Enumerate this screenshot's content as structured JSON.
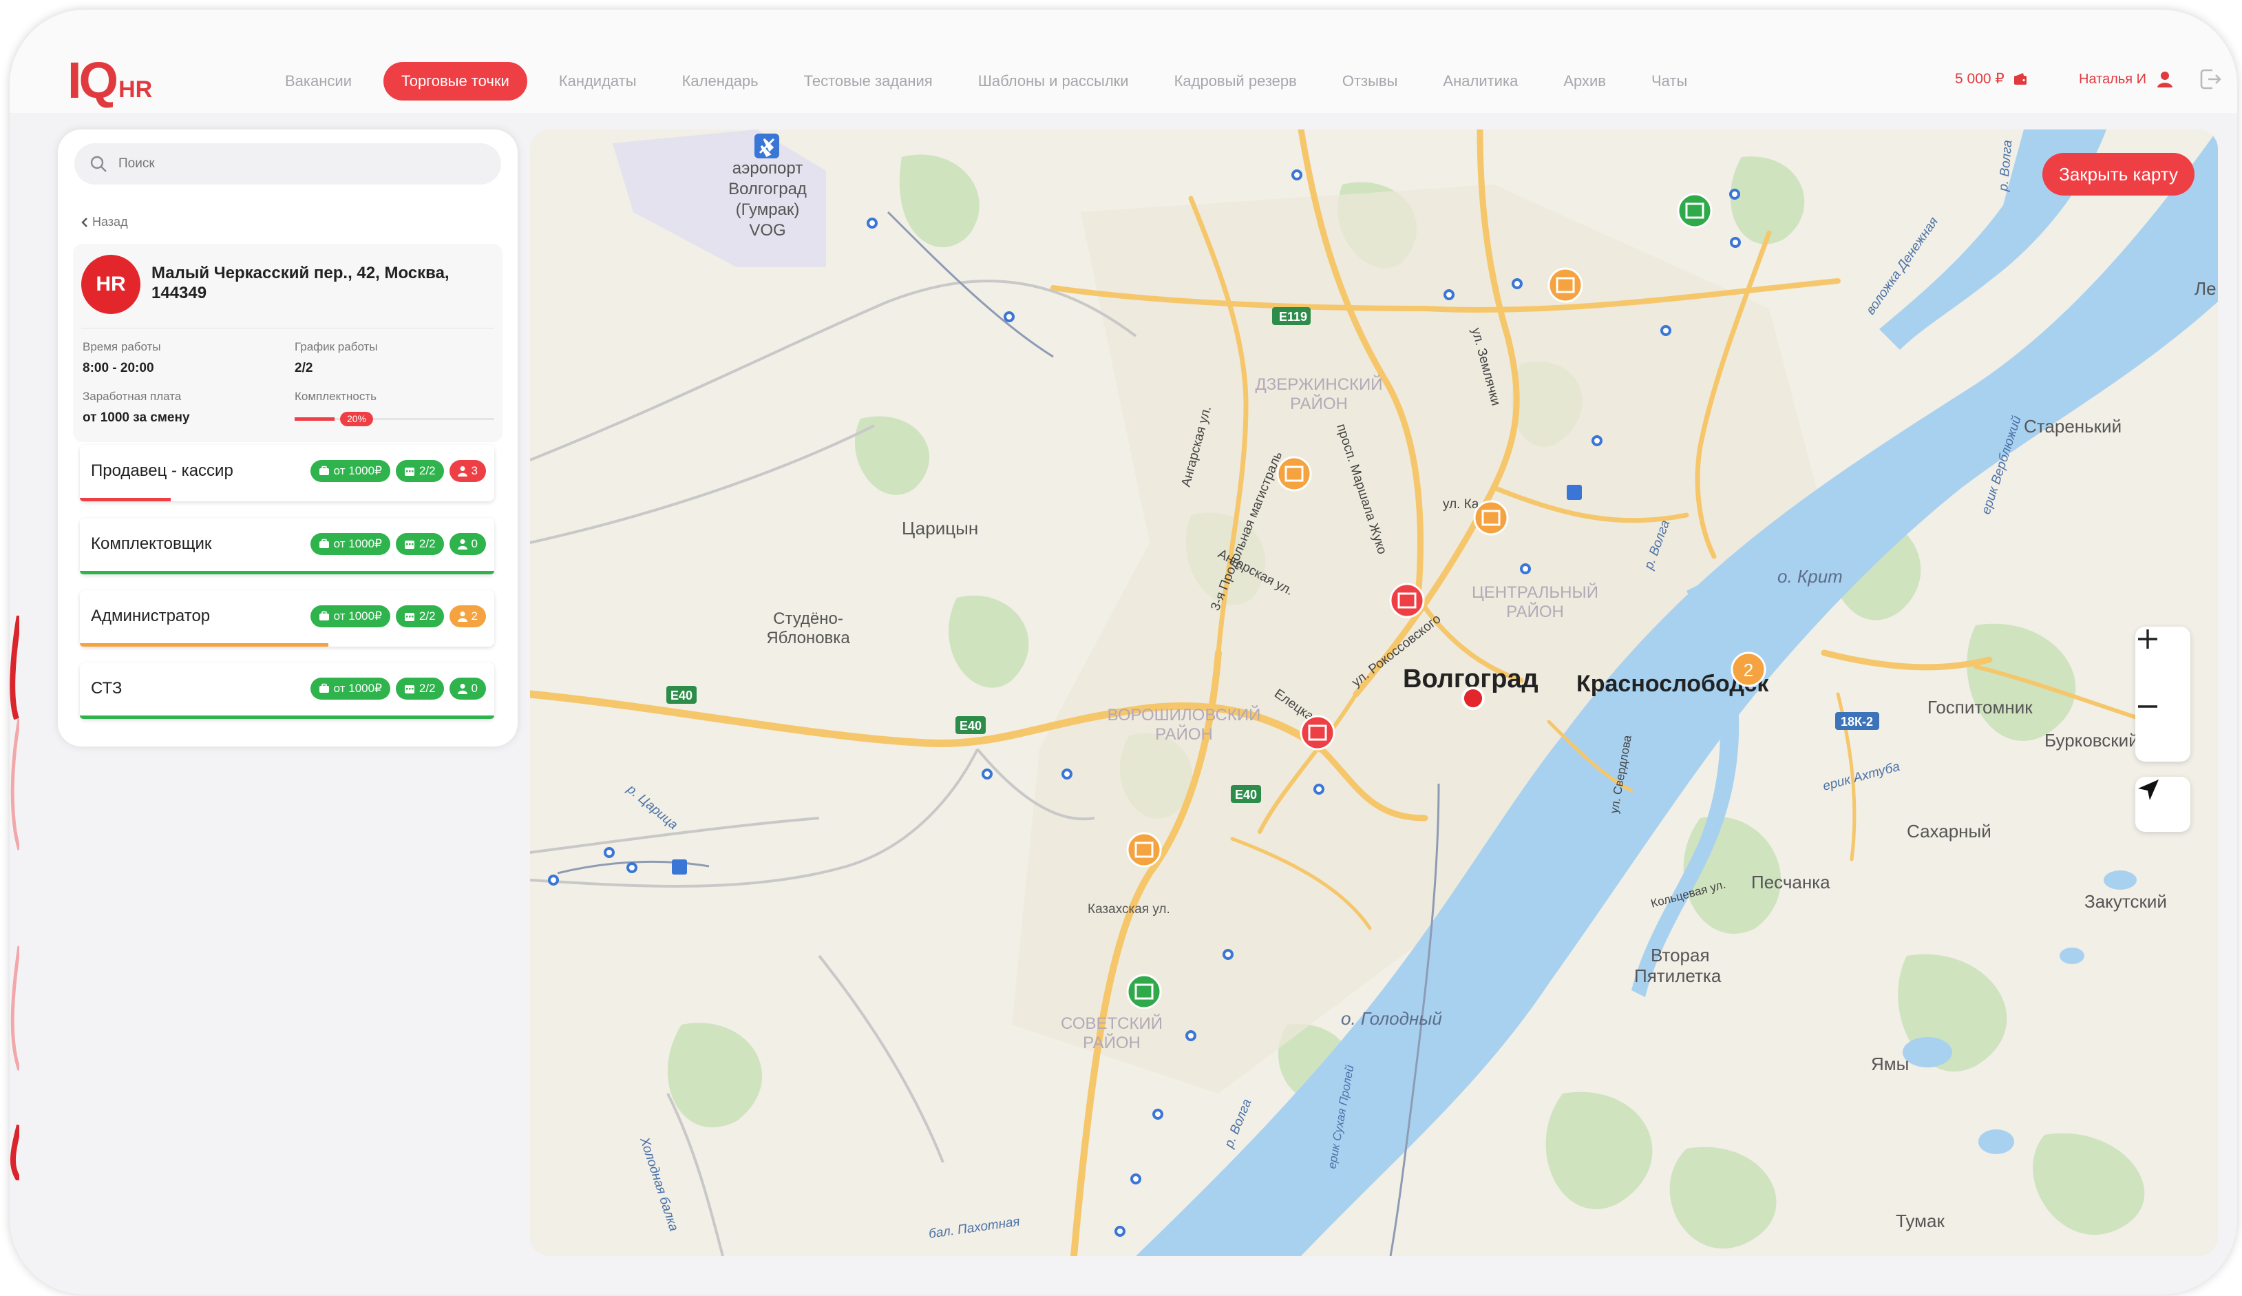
{
  "brand": {
    "logo_main": "IQ",
    "logo_sub": "HR",
    "accent": "#ee3f45"
  },
  "nav": [
    {
      "label": "Вакансии",
      "active": false
    },
    {
      "label": "Торговые точки",
      "active": true
    },
    {
      "label": "Кандидаты",
      "active": false
    },
    {
      "label": "Календарь",
      "active": false
    },
    {
      "label": "Тестовые задания",
      "active": false
    },
    {
      "label": "Шаблоны и рассылки",
      "active": false
    },
    {
      "label": "Кадровый резерв",
      "active": false
    },
    {
      "label": "Отзывы",
      "active": false
    },
    {
      "label": "Аналитика",
      "active": false
    },
    {
      "label": "Архив",
      "active": false
    },
    {
      "label": "Чаты",
      "active": false
    }
  ],
  "header": {
    "balance": "5 000 ₽",
    "user_name": "Наталья И"
  },
  "panel": {
    "search_placeholder": "Поиск",
    "back_label": "Назад",
    "store": {
      "avatar": "HR",
      "address": "Малый Черкасский пер., 42, Москва, 144349",
      "hours_label": "Время работы",
      "hours_value": "8:00 - 20:00",
      "schedule_label": "График работы",
      "schedule_value": "2/2",
      "salary_label": "Заработная плата",
      "salary_value": "от 1000 за смену",
      "completeness_label": "Комплектность",
      "completeness_value": "20%",
      "completeness_fraction": 0.2
    },
    "vacancies": [
      {
        "title": "Продавец - кассир",
        "salary": "от 1000₽",
        "schedule": "2/2",
        "count": "3",
        "status": "red",
        "progress": 0.22
      },
      {
        "title": "Комплектовщик",
        "salary": "от 1000₽",
        "schedule": "2/2",
        "count": "0",
        "status": "green",
        "progress": 1.0
      },
      {
        "title": "Администратор",
        "salary": "от 1000₽",
        "schedule": "2/2",
        "count": "2",
        "status": "orange",
        "progress": 0.6
      },
      {
        "title": "СТЗ",
        "salary": "от 1000₽",
        "schedule": "2/2",
        "count": "0",
        "status": "green",
        "progress": 1.0
      }
    ]
  },
  "map": {
    "close_label": "Закрыть карту",
    "labels": {
      "airport": [
        "аэропорт",
        "Волгоград",
        "(Гумрак)",
        "VOG"
      ],
      "tsaritsyn": "Царицын",
      "studeno": [
        "Студёно-",
        "Яблоновка"
      ],
      "dzerzh": [
        "ДЗЕРЖИНСКИЙ",
        "РАЙОН"
      ],
      "central": [
        "ЦЕНТРАЛЬНЫЙ",
        "РАЙОН"
      ],
      "voroshil": [
        "ВОРОШИЛОВСКИЙ",
        "РАЙОН"
      ],
      "sovetsky": [
        "СОВЕТСКИЙ",
        "РАЙОН"
      ],
      "volgograd": "Волгоград",
      "krasnoslobodsk": "Краснослободск",
      "starenky": "Старенький",
      "gospitomnik": "Госпитомник",
      "burkovsky": "Бурковский",
      "sakharny": "Сахарный",
      "peschanka": "Песчанка",
      "zakutsky": "Закутский",
      "vtoraya": [
        "Вторая",
        "Пятилетка"
      ],
      "yamy": "Ямы",
      "tumak": "Тумак",
      "golodny": "о. Голодный",
      "krit": "о. Крит",
      "le": "Ле",
      "kazakhskaya": "Казахская ул.",
      "elecka": "Елецка",
      "angarskaya": "Ангарская ул.",
      "angarskaya2": "Ангарская ул.",
      "prodolnaya": "3-я Продольная магистраль",
      "rokossovskogo": "ул. Рокоссовского",
      "marshala": "просп. Маршала Жуко",
      "zemlyachki": "ул. Землячки",
      "ulka": "ул. Ка",
      "r_volga": "р. Волга",
      "r_volga2": "р. Волга",
      "r_volga3": "р. Волга",
      "r_tsaritsa": "р. Царица",
      "ahtuba": "ерик Ахтуба",
      "denezhnaya": "воложка Денежная",
      "verbnaya": "ерик Верблюжий",
      "sverdlova": "ул. Свердлова",
      "kolcevaya": "Кольцевая ул.",
      "kholodnaya": "Холодная балка",
      "pahotnaya": "бал. Пахотная",
      "suhaya": "ерик Сухая Пролей",
      "e119": "E119",
      "e40a": "E40",
      "e40b": "E40",
      "e40c": "E40",
      "r18k2": "18К-2",
      "cluster_count": "2"
    }
  },
  "icons": [
    "search-icon",
    "chevron-left-icon",
    "wallet-icon",
    "user-icon",
    "logout-icon",
    "briefcase-icon",
    "calendar-icon",
    "person-icon",
    "store-marker-icon",
    "plus-icon",
    "minus-icon",
    "navigation-arrow-icon",
    "airport-icon"
  ]
}
